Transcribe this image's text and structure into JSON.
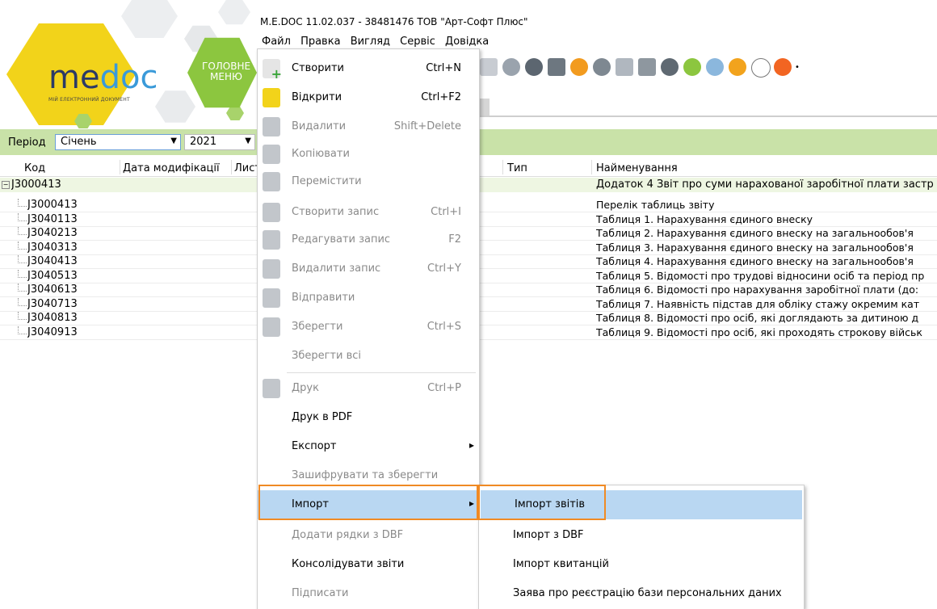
{
  "window": {
    "title": "M.E.DOC 11.02.037  - 38481476 ТОВ \"Арт-Софт Плюс\""
  },
  "menubar": [
    "Файл",
    "Правка",
    "Вигляд",
    "Сервіс",
    "Довідка"
  ],
  "logo": {
    "brand_me": "me",
    "brand_doc": "doc",
    "tagline": "МІЙ ЕЛЕКТРОННИЙ ДОКУМЕНТ",
    "main_menu": "ГОЛОВНЕ МЕНЮ"
  },
  "filter": {
    "period_label": "Період",
    "month": "Січень",
    "year": "2021"
  },
  "table": {
    "headers": [
      "Код",
      "Дата модифікації",
      "Лист",
      "Тип",
      "Найменування"
    ],
    "parent": {
      "code": "J3000413",
      "name": "Додаток 4 Звіт про суми нарахованої заробітної плати застр"
    },
    "rows": [
      {
        "code": "J3000413",
        "name": "Перелік таблиць звіту"
      },
      {
        "code": "J3040113",
        "name": "Таблиця 1. Нарахування єдиного внеску"
      },
      {
        "code": "J3040213",
        "name": "Таблиця 2. Нарахування єдиного внеску на загальнообов'я"
      },
      {
        "code": "J3040313",
        "name": "Таблиця 3. Нарахування єдиного внеску на загальнообов'я"
      },
      {
        "code": "J3040413",
        "name": "Таблиця 4. Нарахування єдиного внеску на загальнообов'я"
      },
      {
        "code": "J3040513",
        "name": "Таблиця 5. Відомості про трудові відносини осіб та період пр"
      },
      {
        "code": "J3040613",
        "name": "Таблиця 6. Відомості про нарахування заробітної плати (до:"
      },
      {
        "code": "J3040713",
        "name": "Таблиця 7. Наявність підстав для обліку стажу окремим кат"
      },
      {
        "code": "J3040813",
        "name": "Таблиця 8. Відомості про осіб, які доглядають за дитиною д"
      },
      {
        "code": "J3040913",
        "name": "Таблиця 9. Відомості про осіб, які проходять строкову військ"
      }
    ]
  },
  "file_menu": [
    {
      "label": "Створити",
      "shortcut": "Ctrl+N",
      "icon": "new-doc-icon",
      "disabled": false
    },
    {
      "label": "Відкрити",
      "shortcut": "Ctrl+F2",
      "icon": "folder-icon",
      "disabled": false
    },
    {
      "label": "Видалити",
      "shortcut": "Shift+Delete",
      "icon": "delete-doc-icon",
      "disabled": true
    },
    {
      "label": "Копіювати",
      "shortcut": "",
      "icon": "copy-icon",
      "disabled": true
    },
    {
      "label": "Перемістити",
      "shortcut": "",
      "icon": "move-icon",
      "disabled": true
    },
    {
      "label": "Створити запис",
      "shortcut": "Ctrl+I",
      "icon": "add-record-icon",
      "disabled": true
    },
    {
      "label": "Редагувати запис",
      "shortcut": "F2",
      "icon": "edit-record-icon",
      "disabled": true
    },
    {
      "label": "Видалити запис",
      "shortcut": "Ctrl+Y",
      "icon": "delete-record-icon",
      "disabled": true
    },
    {
      "label": "Відправити",
      "shortcut": "",
      "icon": "send-icon",
      "disabled": true
    },
    {
      "label": "Зберегти",
      "shortcut": "Ctrl+S",
      "icon": "save-icon",
      "disabled": true
    },
    {
      "label": "Зберегти всі",
      "shortcut": "",
      "icon": "",
      "disabled": true
    },
    {
      "label": "Друк",
      "shortcut": "Ctrl+P",
      "icon": "printer-icon",
      "disabled": true
    },
    {
      "label": "Друк в PDF",
      "shortcut": "",
      "icon": "",
      "disabled": false
    },
    {
      "label": "Експорт",
      "shortcut": "",
      "icon": "",
      "disabled": false
    },
    {
      "label": "Зашифрувати та зберегти",
      "shortcut": "",
      "icon": "",
      "disabled": true
    },
    {
      "label": "Імпорт",
      "shortcut": "",
      "icon": "",
      "disabled": false
    },
    {
      "label": "Додати рядки з DBF",
      "shortcut": "",
      "icon": "",
      "disabled": true
    },
    {
      "label": "Консолідувати звіти",
      "shortcut": "",
      "icon": "",
      "disabled": false
    },
    {
      "label": "Підписати",
      "shortcut": "",
      "icon": "",
      "disabled": true
    }
  ],
  "import_submenu": [
    {
      "label": "Імпорт звітів"
    },
    {
      "label": "Імпорт з DBF"
    },
    {
      "label": "Імпорт квитанцій"
    },
    {
      "label": "Заява про реєстрацію бази персональних даних"
    }
  ],
  "colors": {
    "logo_yellow": "#f2d31a",
    "logo_green": "#8cc63f",
    "filter_bar": "#c9e2a8",
    "highlight": "#b9d7f2",
    "orange_outline": "#f08a24"
  }
}
